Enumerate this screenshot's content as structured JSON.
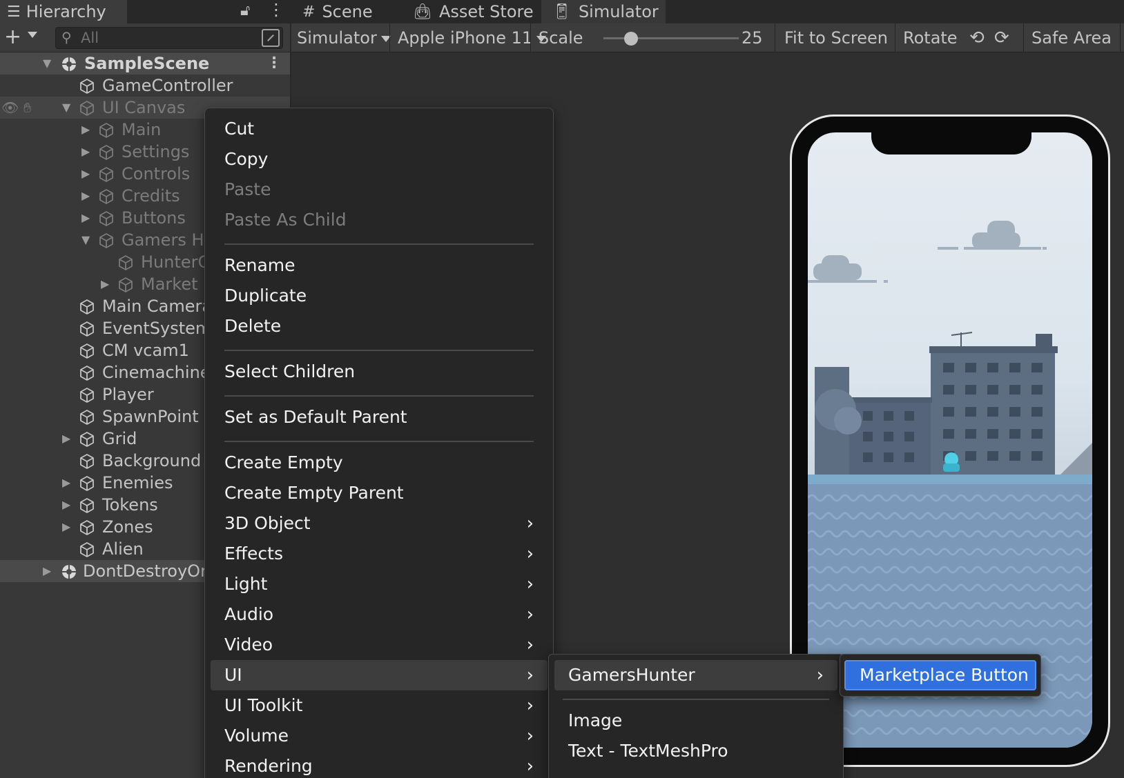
{
  "hierarchy": {
    "tab_title": "Hierarchy",
    "search_placeholder": "All",
    "scene_name": "SampleScene",
    "dont_destroy": "DontDestroyOn",
    "items": [
      {
        "label": "GameController"
      },
      {
        "label": "UI Canvas"
      },
      {
        "label": "Main"
      },
      {
        "label": "Settings"
      },
      {
        "label": "Controls"
      },
      {
        "label": "Credits"
      },
      {
        "label": "Buttons"
      },
      {
        "label": "Gamers Hu"
      },
      {
        "label": "HunterC"
      },
      {
        "label": "Market I"
      },
      {
        "label": "Main Camera"
      },
      {
        "label": "EventSystem"
      },
      {
        "label": "CM vcam1"
      },
      {
        "label": "Cinemachine"
      },
      {
        "label": "Player"
      },
      {
        "label": "SpawnPoint"
      },
      {
        "label": "Grid"
      },
      {
        "label": "Background"
      },
      {
        "label": "Enemies"
      },
      {
        "label": "Tokens"
      },
      {
        "label": "Zones"
      },
      {
        "label": "Alien"
      }
    ]
  },
  "tabs": {
    "scene": "Scene",
    "asset_store": "Asset Store",
    "simulator": "Simulator"
  },
  "simulator_toolbar": {
    "mode": "Simulator",
    "device": "Apple iPhone 11",
    "scale_label": "Scale",
    "scale_value": "25",
    "fit_to_screen": "Fit to Screen",
    "rotate": "Rotate",
    "safe_area": "Safe Area"
  },
  "context_menu": {
    "cut": "Cut",
    "copy": "Copy",
    "paste": "Paste",
    "paste_as_child": "Paste As Child",
    "rename": "Rename",
    "duplicate": "Duplicate",
    "delete": "Delete",
    "select_children": "Select Children",
    "set_default_parent": "Set as Default Parent",
    "create_empty": "Create Empty",
    "create_empty_parent": "Create Empty Parent",
    "object_3d": "3D Object",
    "effects": "Effects",
    "light": "Light",
    "audio": "Audio",
    "video": "Video",
    "ui": "UI",
    "ui_toolkit": "UI Toolkit",
    "volume": "Volume",
    "rendering": "Rendering"
  },
  "ui_submenu": {
    "gamers_hunter": "GamersHunter",
    "image": "Image",
    "text_tmp": "Text - TextMeshPro"
  },
  "gamershunter_submenu": {
    "marketplace_button": "Marketplace Button"
  },
  "colors": {
    "highlight": "#2f6fde",
    "panel": "#383838",
    "menu_bg": "#262626"
  }
}
